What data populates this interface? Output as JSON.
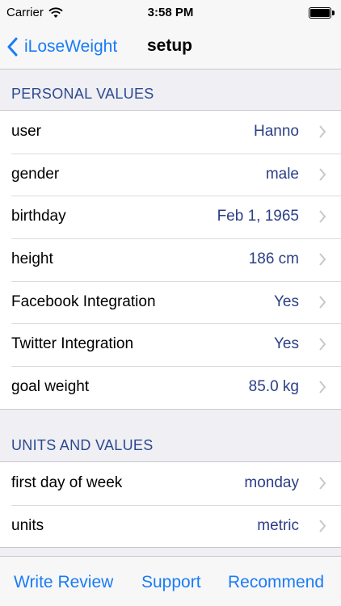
{
  "status_bar": {
    "carrier": "Carrier",
    "time": "3:58 PM"
  },
  "nav": {
    "back_label": "iLoseWeight",
    "title": "setup"
  },
  "sections": [
    {
      "header": "PERSONAL VALUES",
      "rows": [
        {
          "label": "user",
          "value": "Hanno"
        },
        {
          "label": "gender",
          "value": "male"
        },
        {
          "label": "birthday",
          "value": "Feb 1, 1965"
        },
        {
          "label": "height",
          "value": "186 cm"
        },
        {
          "label": "Facebook Integration",
          "value": "Yes"
        },
        {
          "label": "Twitter Integration",
          "value": "Yes"
        },
        {
          "label": "goal weight",
          "value": "85.0 kg"
        }
      ]
    },
    {
      "header": "UNITS AND VALUES",
      "rows": [
        {
          "label": "first day of week",
          "value": "monday"
        },
        {
          "label": "units",
          "value": "metric"
        }
      ]
    }
  ],
  "toolbar": {
    "write_review": "Write Review",
    "support": "Support",
    "recommend": "Recommend"
  },
  "colors": {
    "accent": "#1a7cf5",
    "value_text": "#2b3f86",
    "section_header": "#2b4a8e",
    "background": "#efeff4"
  }
}
